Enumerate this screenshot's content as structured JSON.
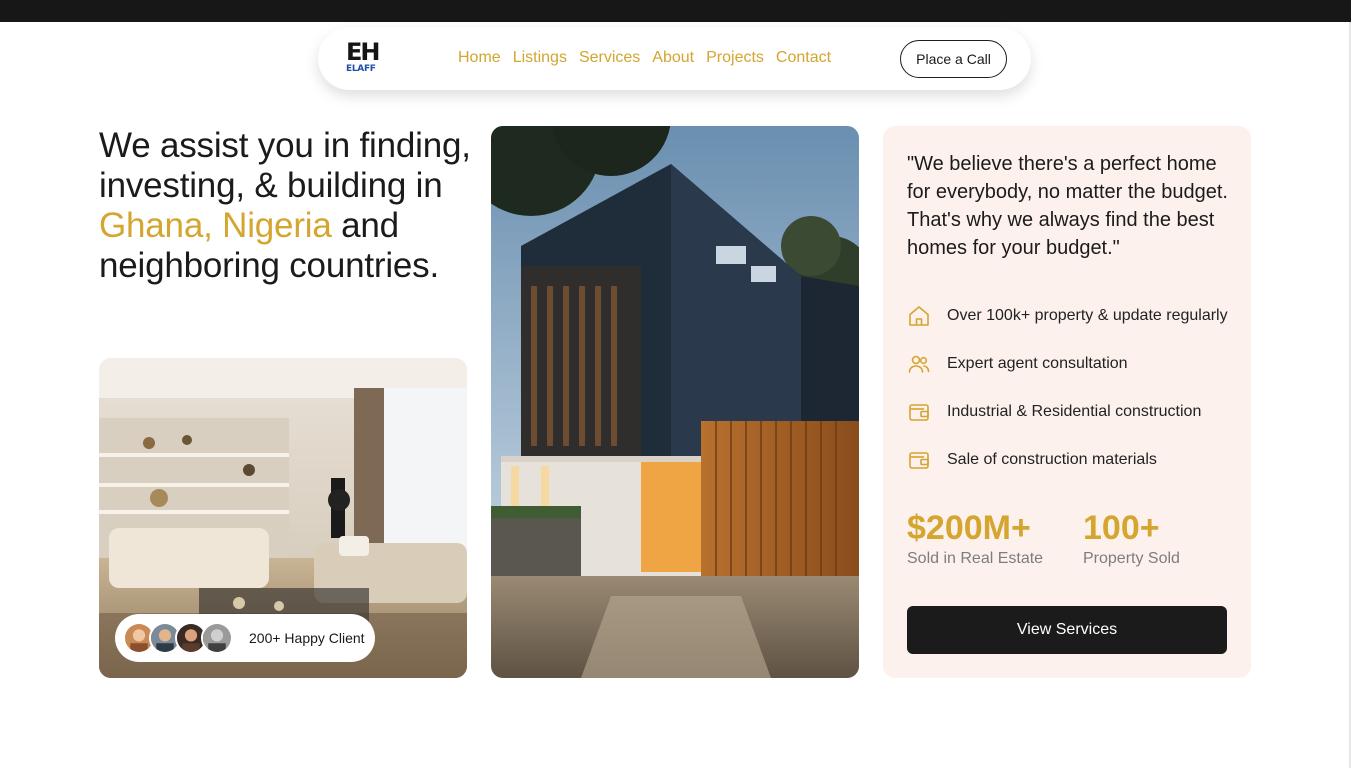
{
  "brand": {
    "logo_mark": "EH",
    "logo_word": "ELAFF",
    "accent_color": "#d4a52f"
  },
  "nav": {
    "links": [
      "Home",
      "Listings",
      "Services",
      "About",
      "Projects",
      "Contact"
    ],
    "call_button": "Place a Call"
  },
  "hero": {
    "headline_part1": "We assist you in finding, investing, & building in ",
    "headline_accent": "Ghana, Nigeria",
    "headline_part2": " and neighboring countries.",
    "clients_label": "200+ Happy Client"
  },
  "panel": {
    "quote": "\"We believe there's a perfect home for everybody, no matter the budget. That's why we always find the best homes for your budget.\"",
    "features": [
      {
        "icon": "home-icon",
        "text": "Over 100k+ property & update regularly"
      },
      {
        "icon": "users-icon",
        "text": "Expert agent consultation"
      },
      {
        "icon": "wallet-icon",
        "text": "Industrial & Residential construction"
      },
      {
        "icon": "wallet-icon",
        "text": "Sale of construction materials"
      }
    ],
    "stats": [
      {
        "value": "$200M+",
        "label": "Sold in Real Estate"
      },
      {
        "value": "100+",
        "label": "Property Sold"
      }
    ],
    "button": "View Services"
  }
}
